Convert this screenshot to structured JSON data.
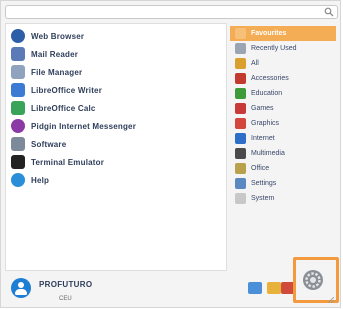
{
  "search": {
    "placeholder": "",
    "value": ""
  },
  "apps": [
    {
      "label": "Web Browser",
      "icon": "web-browser-icon",
      "color": "#2d5fa8"
    },
    {
      "label": "Mail Reader",
      "icon": "mail-reader-icon",
      "color": "#5a7ab8"
    },
    {
      "label": "File Manager",
      "icon": "file-manager-icon",
      "color": "#8fa3bf"
    },
    {
      "label": "LibreOffice Writer",
      "icon": "libreoffice-writer-icon",
      "color": "#3b7bd4"
    },
    {
      "label": "LibreOffice Calc",
      "icon": "libreoffice-calc-icon",
      "color": "#3aa35a"
    },
    {
      "label": "Pidgin Internet Messenger",
      "icon": "pidgin-icon",
      "color": "#8b3aa5"
    },
    {
      "label": "Software",
      "icon": "software-icon",
      "color": "#7d8a9a"
    },
    {
      "label": "Terminal Emulator",
      "icon": "terminal-icon",
      "color": "#222222"
    },
    {
      "label": "Help",
      "icon": "help-icon",
      "color": "#2a8fd8"
    }
  ],
  "categories": [
    {
      "label": "Favourites",
      "icon": "favourites-icon",
      "color": "#f7c078",
      "active": true
    },
    {
      "label": "Recently Used",
      "icon": "recently-used-icon",
      "color": "#9aa4b2",
      "active": false
    },
    {
      "label": "All",
      "icon": "all-icon",
      "color": "#d9a02e",
      "active": false
    },
    {
      "label": "Accessories",
      "icon": "accessories-icon",
      "color": "#c23a2e",
      "active": false
    },
    {
      "label": "Education",
      "icon": "education-icon",
      "color": "#3f9a3a",
      "active": false
    },
    {
      "label": "Games",
      "icon": "games-icon",
      "color": "#c83a3a",
      "active": false
    },
    {
      "label": "Graphics",
      "icon": "graphics-icon",
      "color": "#d2463e",
      "active": false
    },
    {
      "label": "Internet",
      "icon": "internet-icon",
      "color": "#2d6ec8",
      "active": false
    },
    {
      "label": "Multimedia",
      "icon": "multimedia-icon",
      "color": "#4a4a4a",
      "active": false
    },
    {
      "label": "Office",
      "icon": "office-icon",
      "color": "#b8a14a",
      "active": false
    },
    {
      "label": "Settings",
      "icon": "settings-icon",
      "color": "#5a88c0",
      "active": false
    },
    {
      "label": "System",
      "icon": "system-icon",
      "color": "#c8c8c8",
      "active": false
    }
  ],
  "user": {
    "name": "PROFUTURO",
    "sub": "CEU"
  },
  "bottom_icons": [
    {
      "name": "switch-user-icon",
      "color": "#4a8fd8"
    },
    {
      "name": "lock-screen-icon",
      "color": "#e8b23a"
    },
    {
      "name": "logout-icon",
      "color": "#cf4b3c"
    }
  ],
  "highlight_color": "#f39a3c",
  "accent_color": "#f5ad55"
}
